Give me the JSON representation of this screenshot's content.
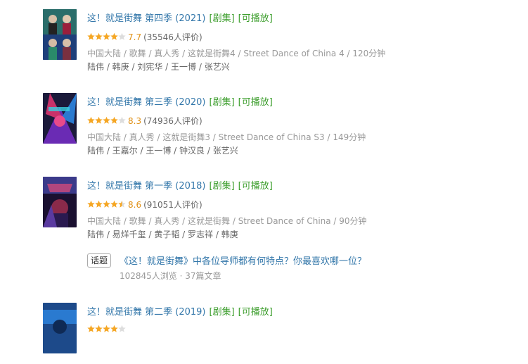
{
  "results": [
    {
      "title": "这！就是街舞 第四季 (2021)",
      "tag_series": "[剧集]",
      "tag_play": "[可播放]",
      "stars": 4,
      "score": "7.7",
      "votes": "(35546人评价)",
      "meta": "中国大陆 / 歌舞 / 真人秀 / 这就是街舞4 / Street Dance of China 4 / 120分钟",
      "cast": "陆伟 / 韩庚 / 刘宪华 / 王一博 / 张艺兴",
      "poster_colors": [
        "#2a6d6a",
        "#9a1f3c",
        "#1e3f7a"
      ]
    },
    {
      "title": "这！就是街舞 第三季 (2020)",
      "tag_series": "[剧集]",
      "tag_play": "[可播放]",
      "stars": 4,
      "score": "8.3",
      "votes": "(74936人评价)",
      "meta": "中国大陆 / 真人秀 / 这就是街舞3 / Street Dance of China S3 / 149分钟",
      "cast": "陆伟 / 王嘉尔 / 王一博 / 钟汉良 / 张艺兴",
      "poster_colors": [
        "#1b1a3a",
        "#c8326a",
        "#6a2bb4"
      ]
    },
    {
      "title": "这！就是街舞 第一季 (2018)",
      "tag_series": "[剧集]",
      "tag_play": "[可播放]",
      "stars": 4.5,
      "score": "8.6",
      "votes": "(91051人评价)",
      "meta": "中国大陆 / 歌舞 / 真人秀 / 这就是街舞 / Street Dance of China / 90分钟",
      "cast": "陆伟 / 易烊千玺 / 黄子韬 / 罗志祥 / 韩庚",
      "poster_colors": [
        "#1a1030",
        "#8a2a4a",
        "#3b3a8a"
      ]
    },
    {
      "title": "这！就是街舞 第二季 (2019)",
      "tag_series": "[剧集]",
      "tag_play": "[可播放]",
      "stars": 4,
      "score": "",
      "votes": "",
      "meta": "",
      "cast": "",
      "poster_colors": [
        "#1d4a8a",
        "#2a7ad0",
        "#0f2a55"
      ]
    }
  ],
  "topic": {
    "badge": "话题",
    "link": "《这！就是街舞》中各位导师都有何特点？你最喜欢哪一位？",
    "stats": "102845人浏览 · 37篇文章"
  },
  "colors": {
    "link": "#3377aa",
    "tag": "#3d9e2d",
    "star": "#f5a623",
    "score": "#e09015"
  }
}
